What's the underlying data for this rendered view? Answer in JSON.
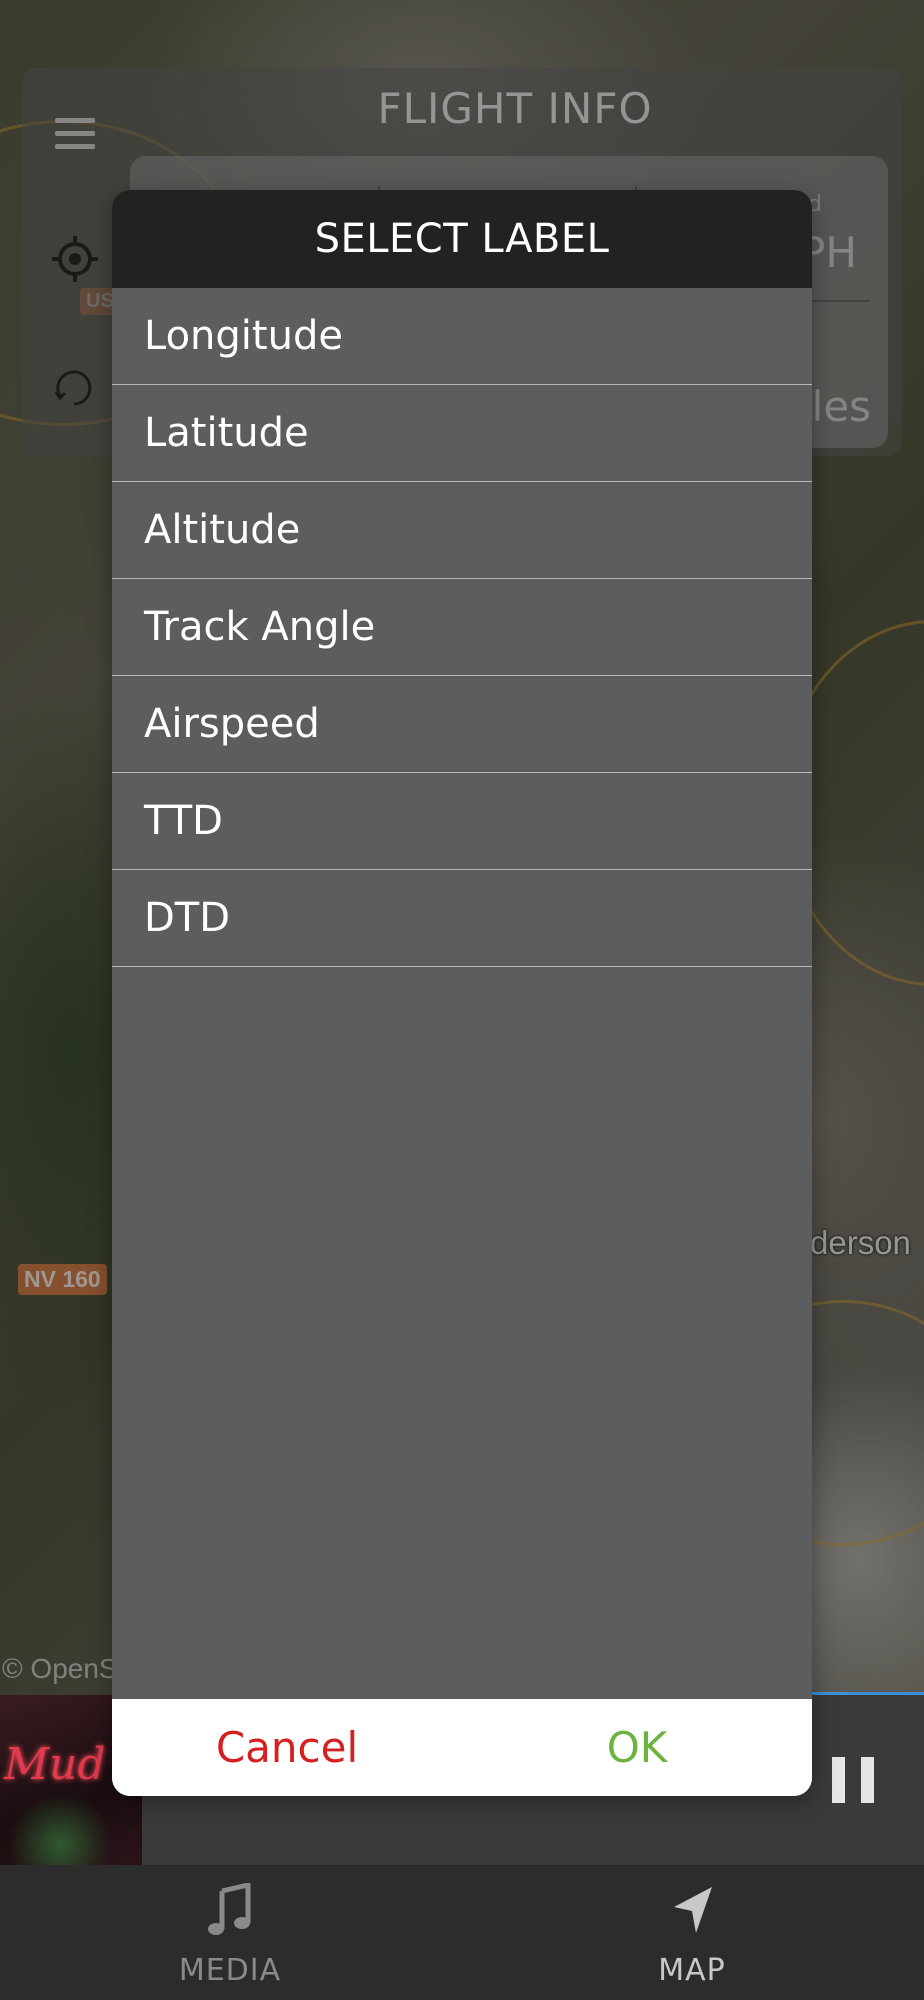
{
  "map": {
    "highway_shield": "NV 160",
    "us_shield": "US",
    "city_label": "derson",
    "attribution": "© OpenS"
  },
  "flight_info": {
    "title": "FLIGHT INFO",
    "speed_unit_partial": "PH",
    "distance_unit_partial": "iles",
    "small_partial": "d"
  },
  "dialog": {
    "title": "SELECT LABEL",
    "options": [
      "Longitude",
      "Latitude",
      "Altitude",
      "Track Angle",
      "Airspeed",
      "TTD",
      "DTD"
    ],
    "cancel_label": "Cancel",
    "ok_label": "OK"
  },
  "now_playing": {
    "album_art_text": "Mud Bug"
  },
  "tabs": [
    {
      "label": "MEDIA",
      "icon": "music-note-icon"
    },
    {
      "label": "MAP",
      "icon": "navigation-arrow-icon"
    }
  ],
  "colors": {
    "cancel": "#d62020",
    "ok": "#6db33f",
    "dialog_header": "#222222",
    "dialog_body": "#5c5d5f"
  }
}
